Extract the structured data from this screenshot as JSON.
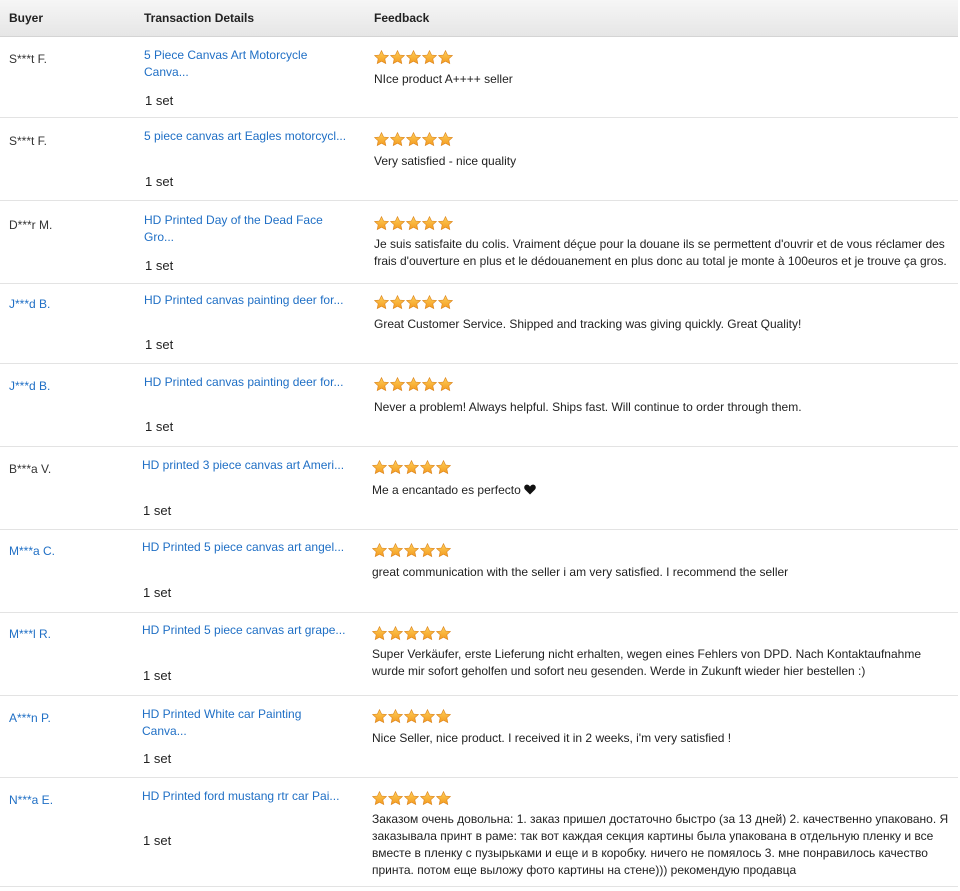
{
  "header": {
    "buyer": "Buyer",
    "details": "Transaction Details",
    "feedback": "Feedback"
  },
  "rows": [
    {
      "buyer": "S***t F.",
      "item": "5 Piece Canvas Art Motorcycle Canva...",
      "qty": "1 set",
      "stars": 5,
      "feedback": "NIce product A++++ seller"
    },
    {
      "buyer": "S***t F.",
      "item": "5 piece canvas art Eagles motorcycl...",
      "qty": "1 set",
      "stars": 5,
      "feedback": "Very satisfied - nice quality"
    },
    {
      "buyer": "D***r M.",
      "item": "HD Printed Day of the Dead Face Gro...",
      "qty": "1 set",
      "stars": 5,
      "feedback": "Je suis satisfaite du colis. Vraiment déçue pour la douane ils se permettent d'ouvrir et de vous réclamer des frais d'ouverture en plus et le dédouanement en plus donc au total je monte à 100euros et je trouve ça gros."
    },
    {
      "buyer": "J***d B.",
      "item": "HD Printed canvas painting deer for...",
      "qty": "1 set",
      "stars": 5,
      "feedback": "Great Customer Service. Shipped and tracking was giving quickly. Great Quality!"
    },
    {
      "buyer": "J***d B.",
      "item": "HD Printed canvas painting deer for...",
      "qty": "1 set",
      "stars": 5,
      "feedback": "Never a problem! Always helpful. Ships fast. Will continue to order through them."
    },
    {
      "buyer": "B***a V.",
      "item": "HD printed 3 piece canvas art Ameri...",
      "qty": "1 set",
      "stars": 5,
      "feedback": "Me a encantado es perfecto"
    },
    {
      "buyer": "M***a C.",
      "item": "HD Printed 5 piece canvas art angel...",
      "qty": "1 set",
      "stars": 5,
      "feedback": "great communication with the seller i am very satisfied. I recommend the seller"
    },
    {
      "buyer": "M***l R.",
      "item": "HD Printed 5 piece canvas art grape...",
      "qty": "1 set",
      "stars": 5,
      "feedback": "Super Verkäufer, erste Lieferung nicht erhalten, wegen eines Fehlers von DPD. Nach Kontaktaufnahme wurde mir sofort geholfen und sofort neu gesenden. Werde in Zukunft wieder hier bestellen :)"
    },
    {
      "buyer": "A***n P.",
      "item": "HD Printed White car Painting Canva...",
      "qty": "1 set",
      "stars": 5,
      "feedback": "Nice Seller, nice product. I received it in 2 weeks, i'm very satisfied !"
    },
    {
      "buyer": "N***a E.",
      "item": "HD Printed ford mustang rtr car Pai...",
      "qty": "1 set",
      "stars": 5,
      "feedback": "Заказом очень довольна: 1. заказ пришел достаточно быстро (за 13 дней) 2. качественно упаковано. Я заказывала принт в раме: так вот каждая секция картины была упакована в отдельную пленку и все вместе в пленку с пузырьками и еще и в коробку. ничего не помялось 3. мне понравилось качество принта. потом еще выложу фото картины на стене))) рекомендую продавца"
    }
  ],
  "colors": {
    "link": "#1f6fc5",
    "star": "#f39a1e",
    "star_light": "#ffcf5a"
  }
}
